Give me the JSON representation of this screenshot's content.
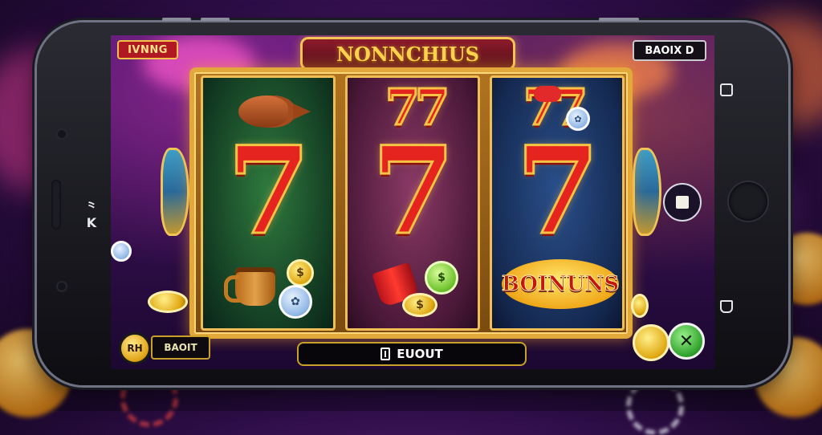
{
  "game": {
    "title": "NONNCHIUS",
    "top_left_tag": "IVNNG",
    "balance_label": "BAOIX  D",
    "bonus_label": "BOINUNS",
    "bet_coin_label": "RH",
    "bet_label": "BAOIT",
    "spin_label": "EUOUT",
    "phone_brand_mark": "⺀K"
  },
  "reels": [
    {
      "top_symbol": "fish-icon",
      "center_symbol": "7",
      "bottom_symbol": "mug-icon"
    },
    {
      "top_symbol": "77",
      "center_symbol": "7",
      "bottom_symbol": "cup-icon"
    },
    {
      "top_symbol": "77",
      "center_symbol": "7",
      "bottom_symbol": "bonus-badge"
    }
  ],
  "colors": {
    "accent_gold": "#f3c553",
    "seven_red": "#e52420",
    "title_red": "#8c1a2a",
    "settings_green": "#2da02a"
  }
}
